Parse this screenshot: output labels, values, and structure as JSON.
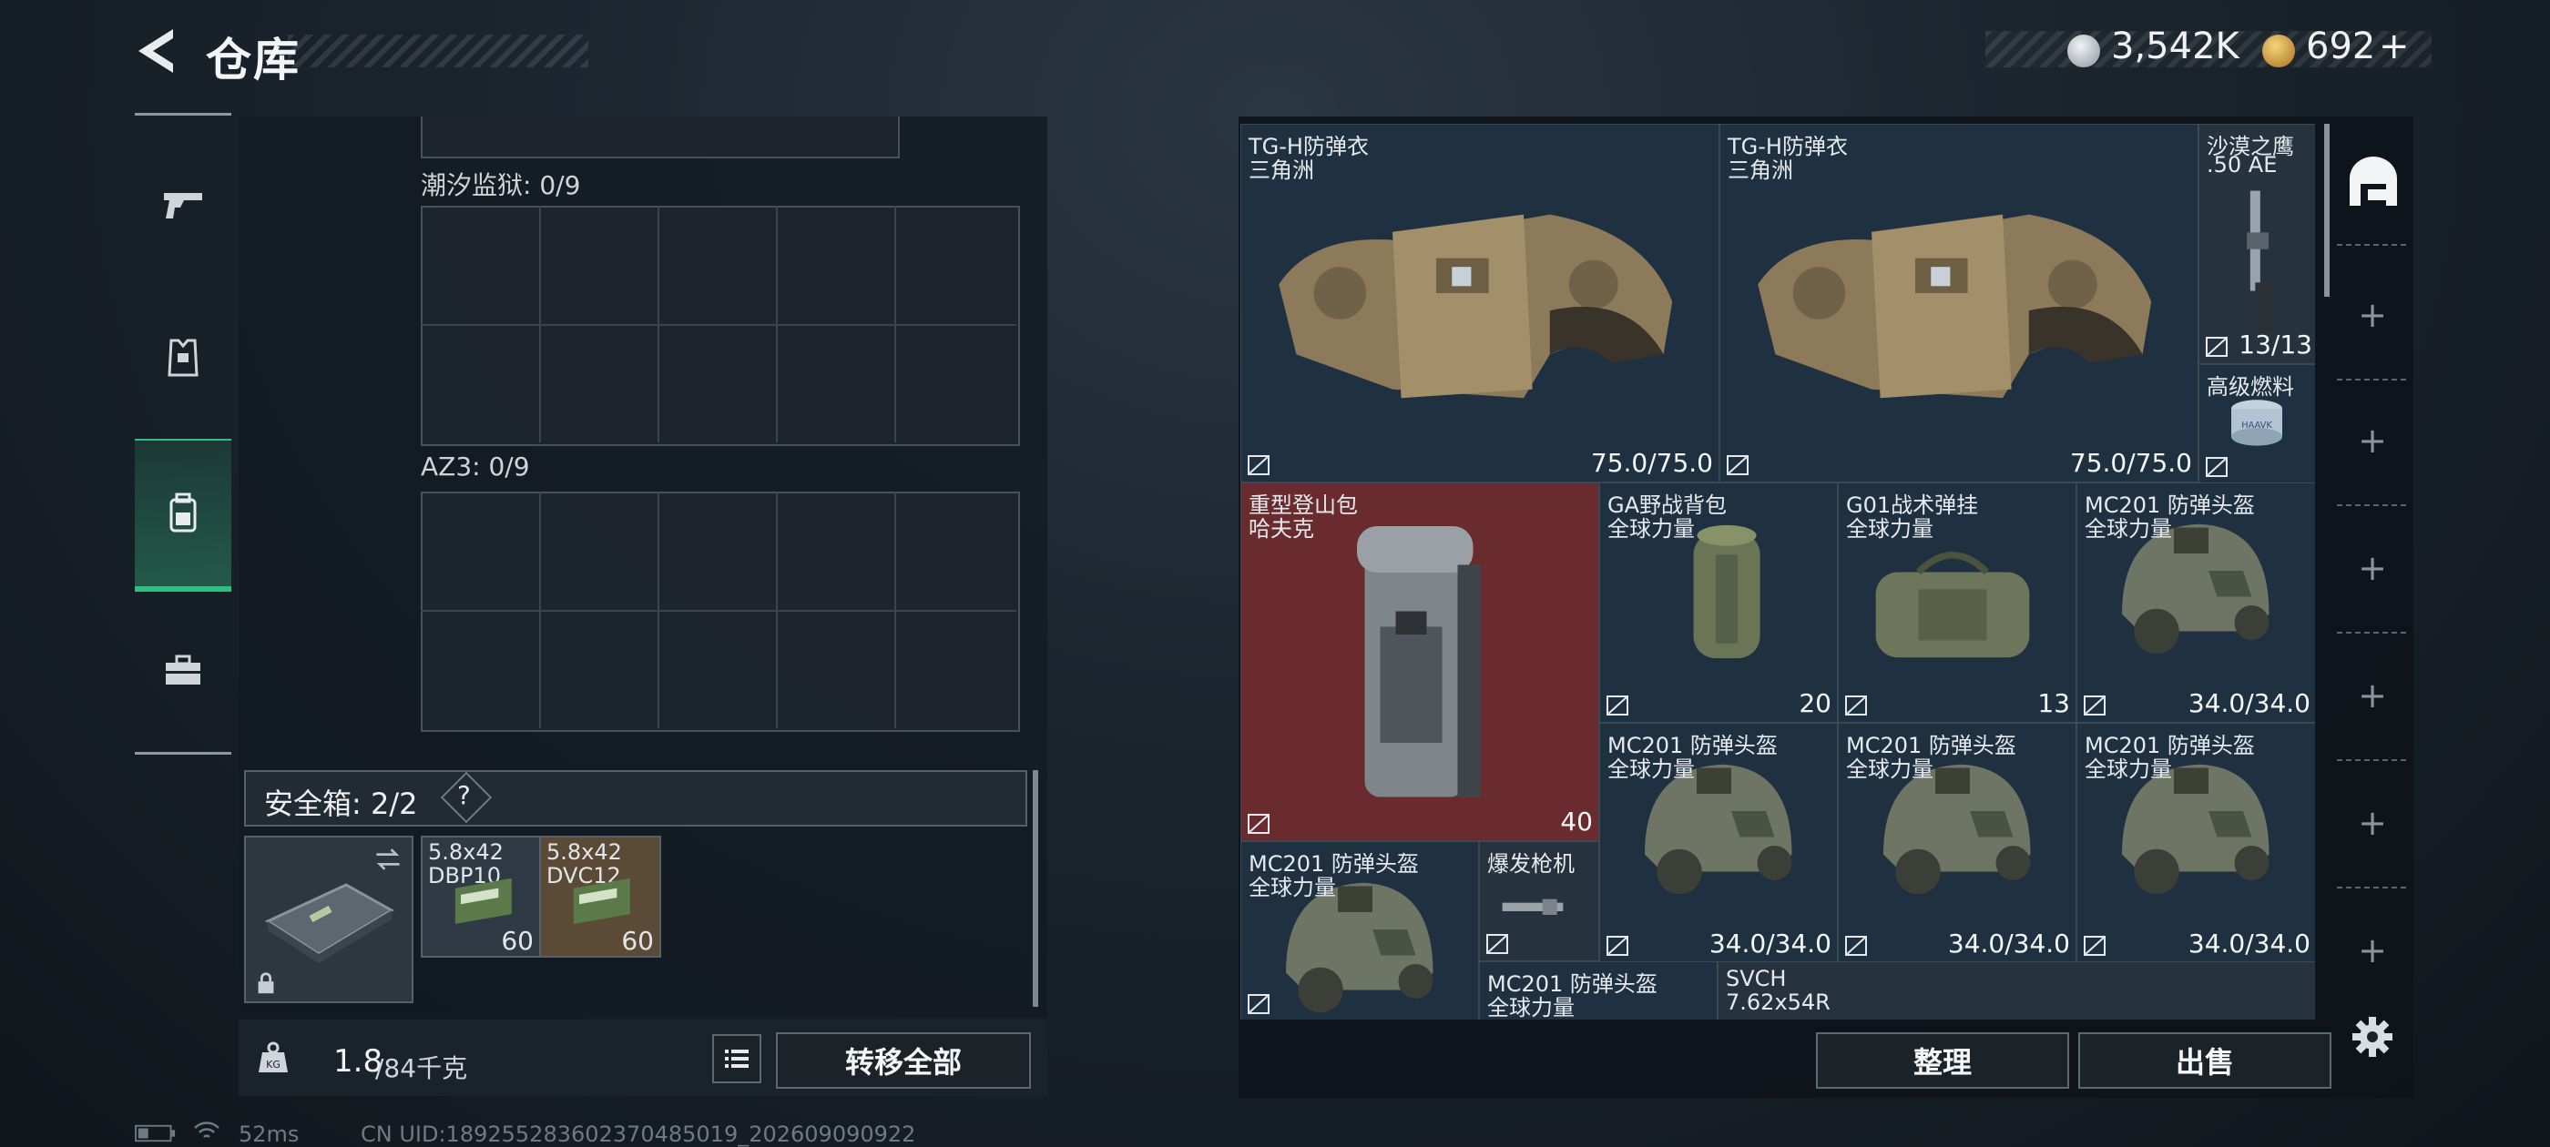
{
  "header": {
    "title": "仓库",
    "back_icon": "back-arrow-icon"
  },
  "currency": [
    {
      "icon": "silver-coin-icon",
      "value": "3,542K",
      "color": "#c9ced3"
    },
    {
      "icon": "gold-coin-icon",
      "value": "692",
      "add": "+",
      "color": "#d9a545"
    }
  ],
  "nav": [
    {
      "icon": "pistol-icon",
      "active": false
    },
    {
      "icon": "armor-vest-icon",
      "active": false
    },
    {
      "icon": "backpack-icon",
      "active": true
    },
    {
      "icon": "toolbox-icon",
      "active": false
    }
  ],
  "stash": {
    "sections": [
      {
        "label": "潮汐监狱: 0/9"
      },
      {
        "label": "AZ3: 0/9"
      }
    ],
    "safe_box": {
      "label": "安全箱: 2/2",
      "help": "?"
    },
    "safe_items": [
      {
        "name": "5.8x42",
        "sub": "DBP10",
        "count": "60",
        "color": "#2f3a45"
      },
      {
        "name": "5.8x42",
        "sub": "DVC12",
        "count": "60",
        "color": "#5a4a36"
      }
    ],
    "weight": {
      "current": "1.8",
      "max": "/84千克",
      "unit_icon": "kg-weight-icon"
    },
    "transfer_all": "转移全部"
  },
  "inventory": [
    {
      "id": "tgh1",
      "name": "TG-H防弹衣",
      "source": "三角洲",
      "value": "75.0/75.0",
      "bg": "#1f3040"
    },
    {
      "id": "tgh2",
      "name": "TG-H防弹衣",
      "source": "三角洲",
      "value": "75.0/75.0",
      "bg": "#1f3040"
    },
    {
      "id": "deagle",
      "name": "沙漠之鹰",
      "source": ".50 AE",
      "value": "13/13",
      "bg": "#26333f"
    },
    {
      "id": "fuel",
      "name": "高级燃料",
      "source": "",
      "value": "",
      "bg": "#1f3040"
    },
    {
      "id": "hiking",
      "name": "重型登山包",
      "source": "哈夫克",
      "value": "40",
      "bg": "#6a2b2f"
    },
    {
      "id": "ga",
      "name": "GA野战背包",
      "source": "全球力量",
      "value": "20",
      "bg": "#1f3040"
    },
    {
      "id": "g01",
      "name": "G01战术弹挂",
      "source": "全球力量",
      "value": "13",
      "bg": "#1f3040"
    },
    {
      "id": "mc1",
      "name": "MC201 防弹头盔",
      "source": "全球力量",
      "value": "34.0/34.0",
      "bg": "#1f3040"
    },
    {
      "id": "mc2",
      "name": "MC201 防弹头盔",
      "source": "全球力量",
      "value": "34.0/34.0",
      "bg": "#1f3040"
    },
    {
      "id": "mc3",
      "name": "MC201 防弹头盔",
      "source": "全球力量",
      "value": "34.0/34.0",
      "bg": "#1f3040"
    },
    {
      "id": "mc4",
      "name": "MC201 防弹头盔",
      "source": "全球力量",
      "value": "34.0/34.0",
      "bg": "#1f3040"
    },
    {
      "id": "mc5",
      "name": "MC201 防弹头盔",
      "source": "全球力量",
      "value": "",
      "bg": "#1f3040"
    },
    {
      "id": "burst",
      "name": "爆发枪机",
      "source": "",
      "value": "",
      "bg": "#26333f"
    },
    {
      "id": "mc6",
      "name": "MC201 防弹头盔",
      "source": "全球力量",
      "value": "",
      "bg": "#1f3040"
    },
    {
      "id": "svch",
      "name": "SVCH",
      "source": "7.62x54R",
      "value": "",
      "bg": "#26333f"
    }
  ],
  "actions": {
    "sort": "整理",
    "sell": "出售",
    "settings_icon": "gear-icon"
  },
  "side_icons": {
    "top": "equipment-slot-icon",
    "add": "+"
  },
  "status": {
    "ping": "52ms",
    "uid": "CN UID:18925528360237048​5019_202609090922",
    "battery_icon": "battery-icon",
    "wifi_icon": "wifi-icon"
  }
}
